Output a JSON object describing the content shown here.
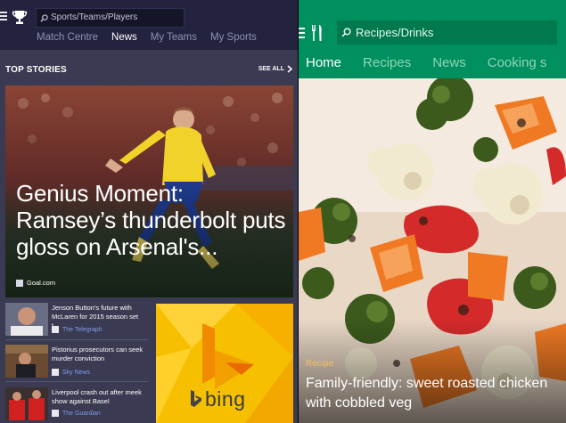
{
  "sports_app": {
    "search_placeholder": "Sports/Teams/Players",
    "nav": [
      {
        "label": "Match Centre",
        "active": false
      },
      {
        "label": "News",
        "active": true
      },
      {
        "label": "My Teams",
        "active": false
      },
      {
        "label": "My Sports",
        "active": false
      }
    ],
    "section_title": "TOP STORIES",
    "see_all": "SEE ALL",
    "hero": {
      "headline": "Genius Moment: Ramsey’s thunderbolt puts gloss on Arsenal's...",
      "source": "Goal.com"
    },
    "news_items": [
      {
        "headline": "Jenson Button's future with McLaren for 2015 season set t...",
        "source": "The Telegraph"
      },
      {
        "headline": "Pistorius prosecutors can seek murder conviction",
        "source": "Sky News"
      },
      {
        "headline": "Liverpool crash out after meek show against Basel",
        "source": "The Guardian"
      }
    ],
    "ad": {
      "brand": "bing"
    },
    "colors": {
      "header": "#23233f",
      "body": "#3a3a52",
      "nav_active": "#ffffff",
      "nav_inactive": "#8f8fb6",
      "source_link": "#7e9ee6",
      "ad_bg": "#f6c000"
    }
  },
  "food_app": {
    "search_placeholder": "Recipes/Drinks",
    "nav": [
      {
        "label": "Home",
        "active": true
      },
      {
        "label": "Recipes",
        "active": false
      },
      {
        "label": "News",
        "active": false
      },
      {
        "label": "Cooking s",
        "active": false
      }
    ],
    "feature": {
      "category": "Recipe",
      "title": "Family-friendly: sweet roasted chicken with cobbled veg"
    },
    "colors": {
      "header": "#008f5e",
      "search_bg": "#00794f",
      "category": "#f5c060"
    }
  }
}
